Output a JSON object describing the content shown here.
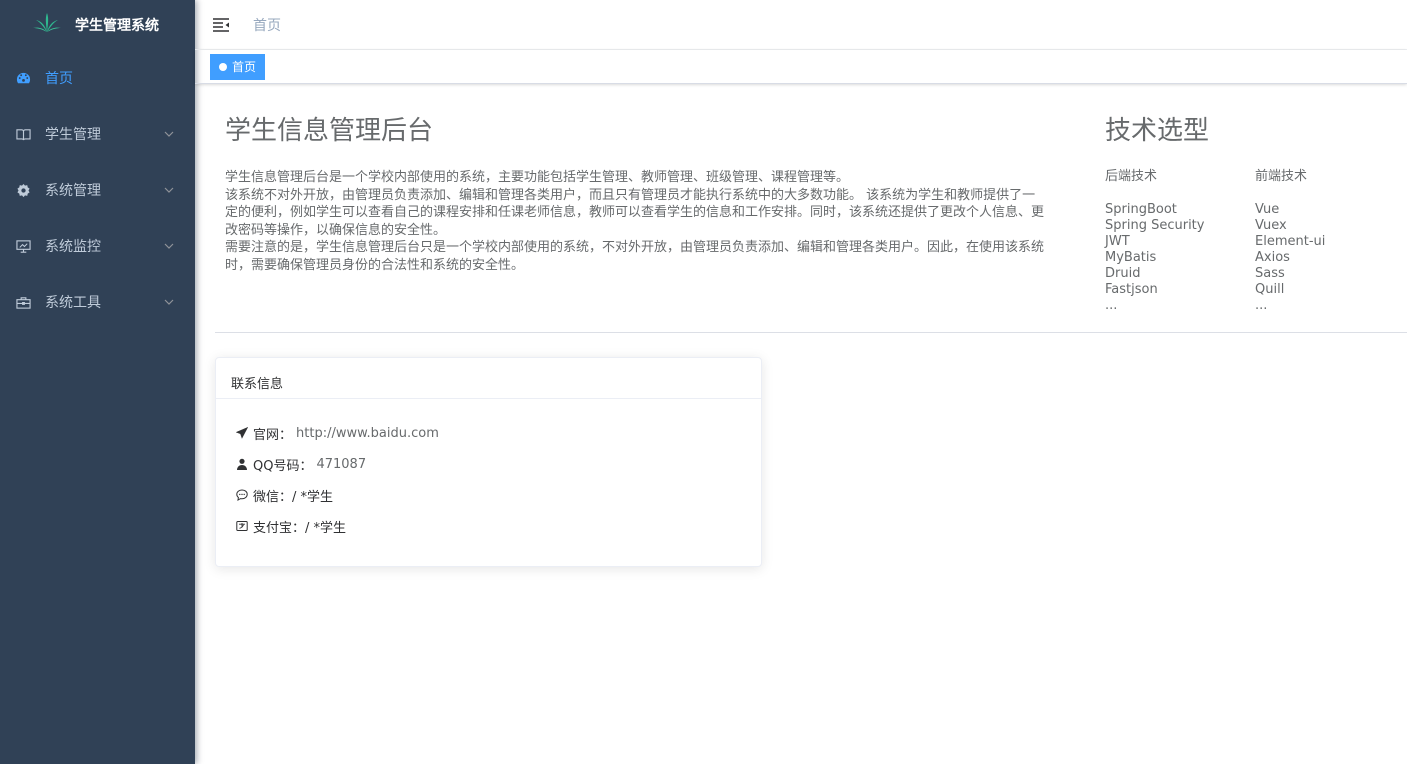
{
  "app": {
    "title": "学生管理系统"
  },
  "sidebar": {
    "items": [
      {
        "label": "首页",
        "icon": "dashboard-icon",
        "active": true
      },
      {
        "label": "学生管理",
        "icon": "book-icon",
        "active": false
      },
      {
        "label": "系统管理",
        "icon": "gear-icon",
        "active": false
      },
      {
        "label": "系统监控",
        "icon": "monitor-icon",
        "active": false
      },
      {
        "label": "系统工具",
        "icon": "toolbox-icon",
        "active": false
      }
    ]
  },
  "navbar": {
    "breadcrumb": "首页"
  },
  "tags": [
    {
      "label": "首页",
      "active": true
    }
  ],
  "intro": {
    "title": "学生信息管理后台",
    "paragraphs": [
      "学生信息管理后台是一个学校内部使用的系统，主要功能包括学生管理、教师管理、班级管理、课程管理等。",
      "该系统不对外开放，由管理员负责添加、编辑和管理各类用户，而且只有管理员才能执行系统中的大多数功能。 该系统为学生和教师提供了一定的便利，例如学生可以查看自己的课程安排和任课老师信息，教师可以查看学生的信息和工作安排。同时，该系统还提供了更改个人信息、更改密码等操作，以确保信息的安全性。",
      "需要注意的是，学生信息管理后台只是一个学校内部使用的系统，不对外开放，由管理员负责添加、编辑和管理各类用户。因此，在使用该系统时，需要确保管理员身份的合法性和系统的安全性。"
    ]
  },
  "tech": {
    "title": "技术选型",
    "backend": {
      "heading": "后端技术",
      "items": [
        "SpringBoot",
        "Spring Security",
        "JWT",
        "MyBatis",
        "Druid",
        "Fastjson",
        "..."
      ]
    },
    "frontend": {
      "heading": "前端技术",
      "items": [
        "Vue",
        "Vuex",
        "Element-ui",
        "Axios",
        "Sass",
        "Quill",
        "..."
      ]
    }
  },
  "contact": {
    "title": "联系信息",
    "website_label": "官网：",
    "website_value": "http://www.baidu.com",
    "qq_label": "QQ号码：",
    "qq_value": "471087",
    "wechat_label": "微信：",
    "wechat_value": "/ *学生",
    "alipay_label": "支付宝：",
    "alipay_value": "/ *学生"
  },
  "colors": {
    "sidebar_bg": "#304156",
    "sidebar_text": "#bfcbd9",
    "accent": "#409eff",
    "body_text": "#676a6c"
  }
}
